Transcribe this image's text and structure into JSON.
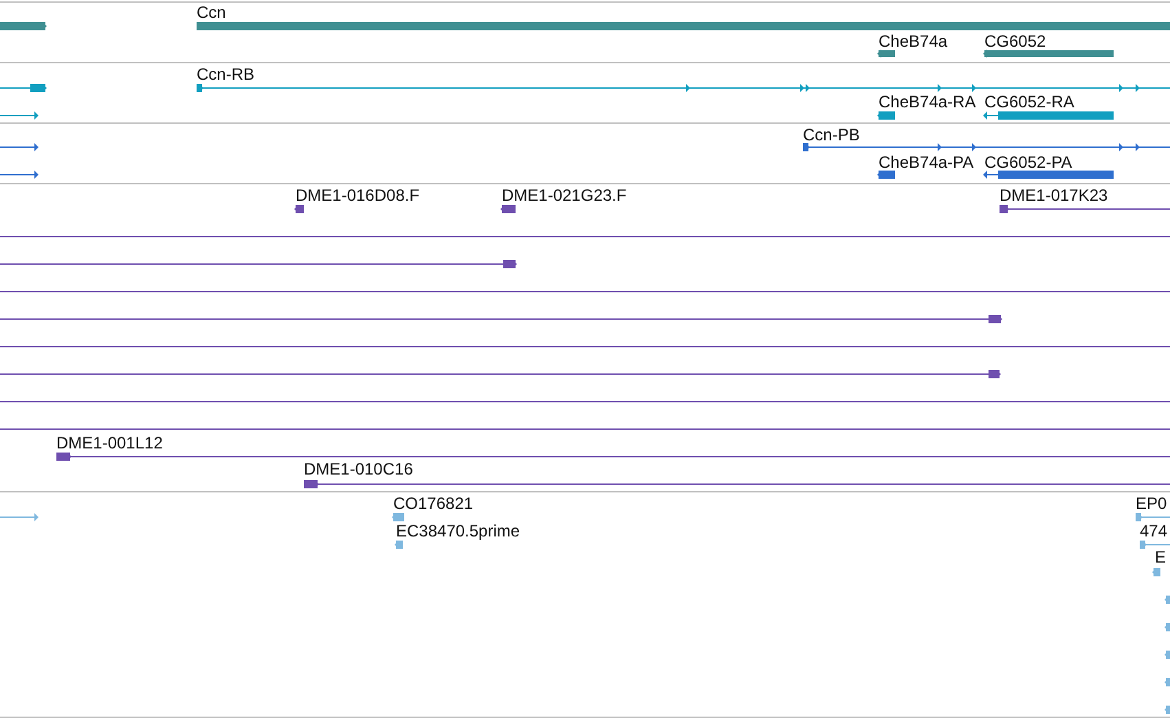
{
  "tracks": [
    {
      "features": [
        {
          "reverse": false
        },
        {
          "label": "Ccn",
          "reverse": false
        },
        {
          "label": "CheB74a",
          "reverse": true
        },
        {
          "label": "CG6052",
          "reverse": true
        }
      ]
    },
    {
      "features": [
        {
          "reverse": false
        },
        {
          "reverse": false
        },
        {
          "label": "Ccn-RB",
          "reverse": false
        },
        {
          "label": "CheB74a-RA",
          "reverse": true
        },
        {
          "label": "CG6052-RA",
          "reverse": true
        }
      ]
    },
    {
      "features": [
        {
          "reverse": false
        },
        {
          "reverse": false
        },
        {
          "label": "Ccn-PB",
          "reverse": false
        },
        {
          "label": "CheB74a-PA",
          "reverse": true
        },
        {
          "label": "CG6052-PA",
          "reverse": true
        }
      ]
    },
    {
      "features": [
        {
          "label": "DME1-016D08.F",
          "reverse": true
        },
        {
          "label": "DME1-021G23.F",
          "reverse": true
        },
        {
          "label": "DME1-017K23",
          "reverse": false
        },
        {
          "kind": "span"
        },
        {
          "reverse": false
        },
        {
          "kind": "span"
        },
        {
          "reverse": false
        },
        {
          "kind": "span"
        },
        {
          "reverse": false
        },
        {
          "kind": "span"
        },
        {
          "kind": "span"
        },
        {
          "label": "DME1-001L12",
          "reverse": false
        },
        {
          "label": "DME1-010C16",
          "reverse": false
        }
      ]
    },
    {
      "features": [
        {
          "reverse": false
        },
        {
          "label": "CO176821",
          "reverse": true
        },
        {
          "label": "EC38470.5prime",
          "reverse": true
        },
        {
          "label": "EP0",
          "reverse": false
        },
        {
          "label": "474",
          "reverse": false
        },
        {
          "label": "E",
          "reverse": true
        },
        {
          "reverse": true
        },
        {
          "reverse": true
        },
        {
          "reverse": true
        },
        {
          "reverse": true
        },
        {
          "reverse": true
        }
      ]
    }
  ]
}
